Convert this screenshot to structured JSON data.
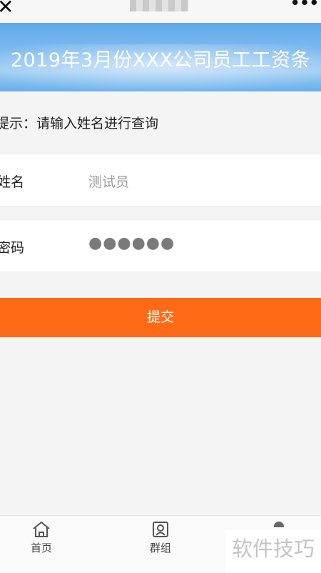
{
  "topbar": {
    "close_glyph": "✕",
    "more_glyph": "•••"
  },
  "banner": {
    "title": "2019年3月份XXX公司员工工资条"
  },
  "hint": {
    "text": "提示：请输入姓名进行查询"
  },
  "form": {
    "name_label": "姓名",
    "name_value": "测试员",
    "password_label": "密码",
    "password_value": "●●●●●●"
  },
  "submit": {
    "label": "提交"
  },
  "tabbar": {
    "items": [
      {
        "label": "首页",
        "icon": "home-icon"
      },
      {
        "label": "群组",
        "icon": "group-icon"
      }
    ]
  },
  "watermark": {
    "text": "软件技巧"
  },
  "colors": {
    "accent": "#ff6a16",
    "banner": "#7db9ef"
  }
}
